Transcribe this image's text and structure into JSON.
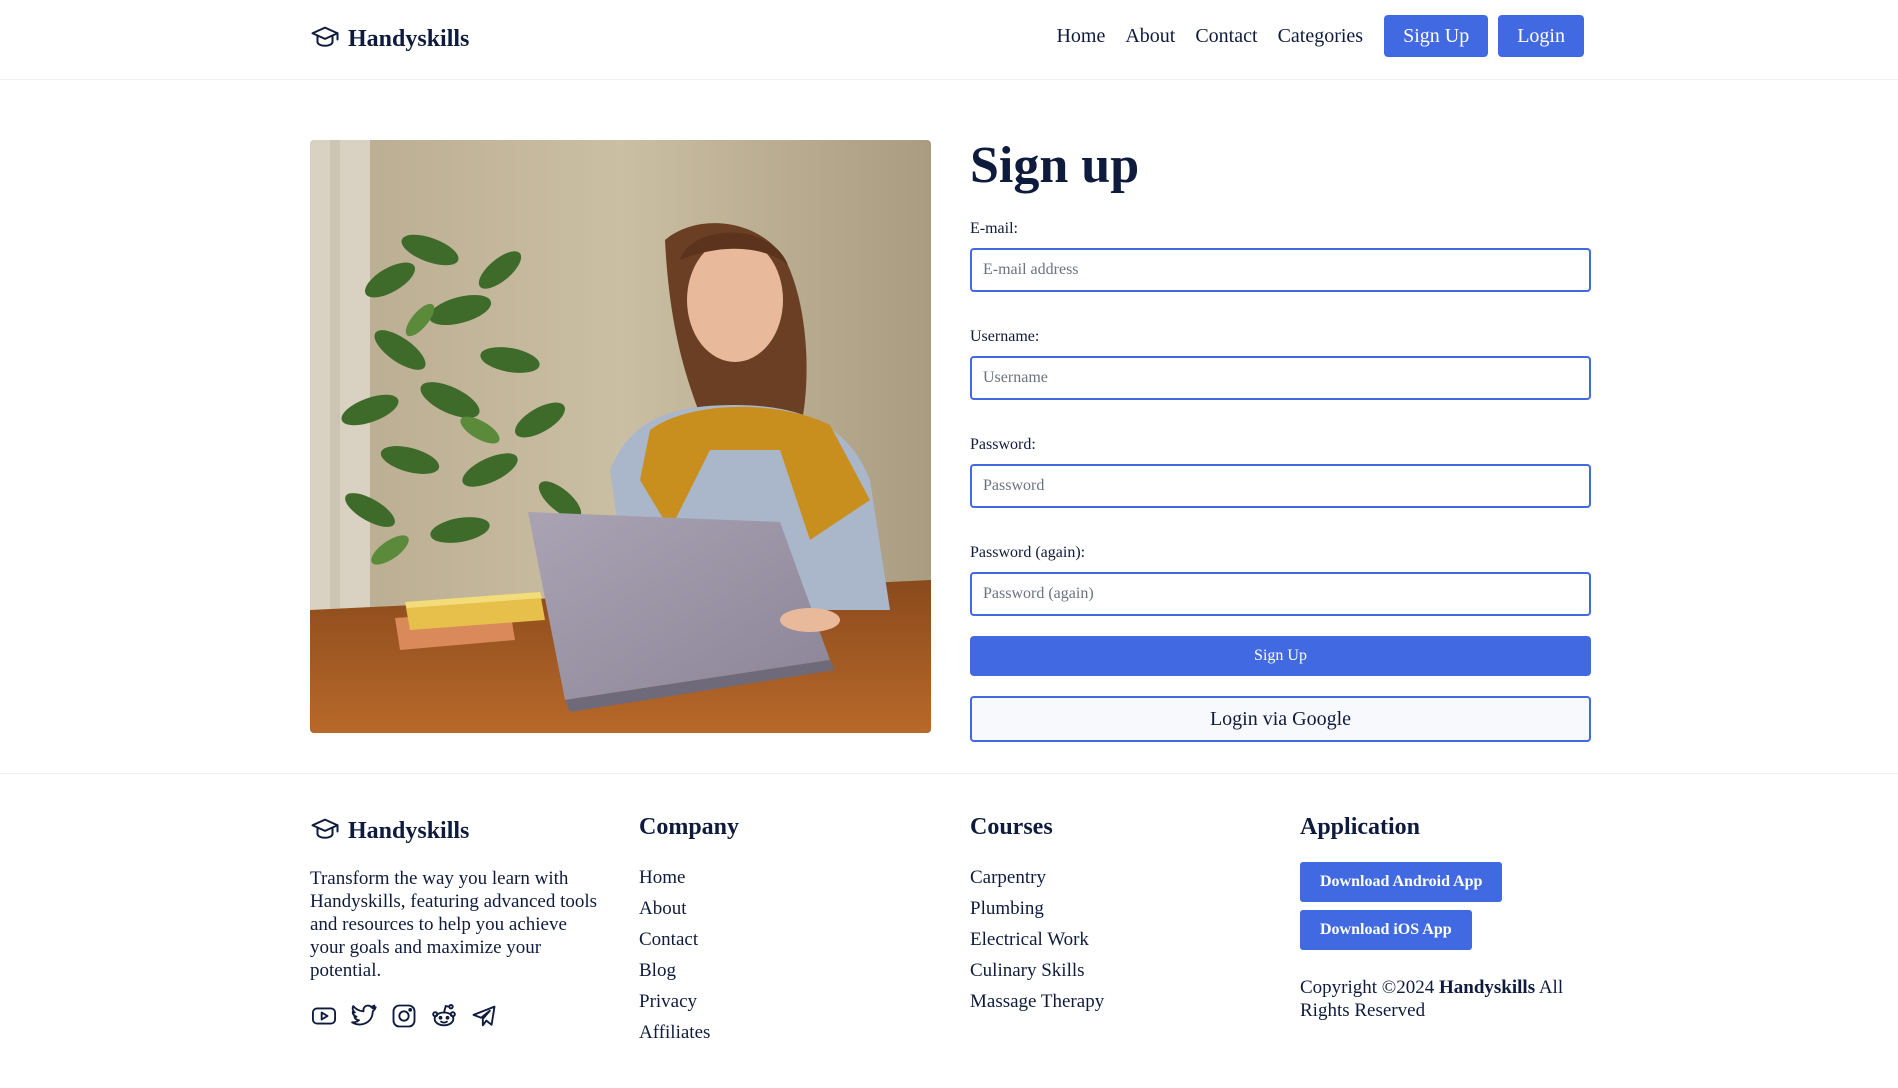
{
  "header": {
    "brand": "Handyskills",
    "nav": [
      "Home",
      "About",
      "Contact",
      "Categories"
    ],
    "signup_label": "Sign Up",
    "login_label": "Login"
  },
  "form": {
    "title": "Sign up",
    "email_label": "E-mail:",
    "email_placeholder": "E-mail address",
    "username_label": "Username:",
    "username_placeholder": "Username",
    "password_label": "Password:",
    "password_placeholder": "Password",
    "password2_label": "Password (again):",
    "password2_placeholder": "Password (again)",
    "submit_label": "Sign Up",
    "google_label": "Login via Google"
  },
  "footer": {
    "brand": "Handyskills",
    "description": "Transform the way you learn with Handyskills, featuring advanced tools and resources to help you achieve your goals and maximize your potential.",
    "socials": [
      "youtube-icon",
      "twitter-icon",
      "instagram-icon",
      "reddit-icon",
      "telegram-icon"
    ],
    "company": {
      "title": "Company",
      "links": [
        "Home",
        "About",
        "Contact",
        "Blog",
        "Privacy",
        "Affiliates"
      ]
    },
    "courses": {
      "title": "Courses",
      "links": [
        "Carpentry",
        "Plumbing",
        "Electrical Work",
        "Culinary Skills",
        "Massage Therapy"
      ]
    },
    "application": {
      "title": "Application",
      "android_label": "Download Android App",
      "ios_label": "Download iOS App",
      "copyright_prefix": "Copyright ©2024",
      "copyright_brand": "Handyskills",
      "copyright_suffix": "All Rights Reserved"
    }
  },
  "colors": {
    "accent": "#4169e1",
    "text": "#0f1b3d"
  }
}
